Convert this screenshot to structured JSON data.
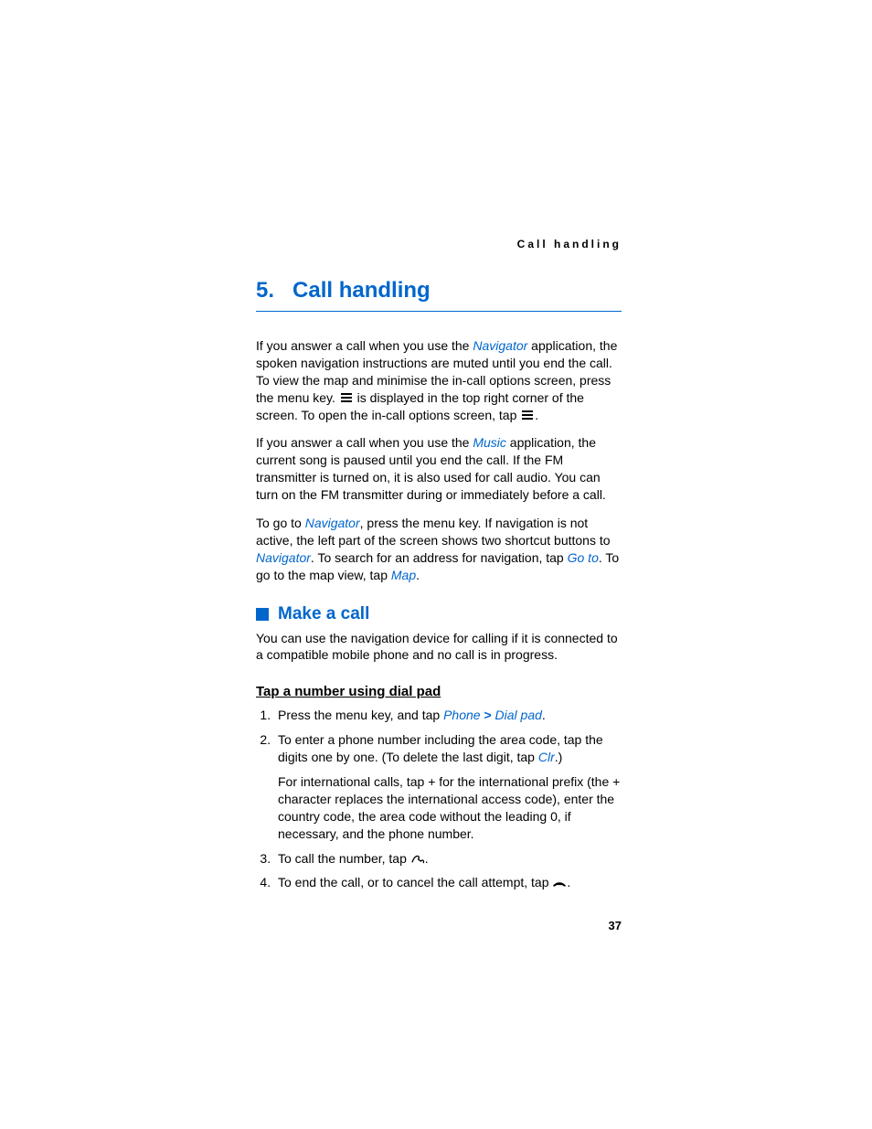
{
  "running_header": "Call handling",
  "chapter": {
    "number": "5.",
    "title": "Call handling"
  },
  "paragraphs": {
    "p1_a": "If you answer a call when you use the ",
    "p1_link1": "Navigator",
    "p1_b": " application, the spoken navigation instructions are muted until you end the call. To view the map and minimise the in-call options screen, press the menu key. ",
    "p1_c": " is displayed in the top right corner of the screen. To open the in-call options screen, tap ",
    "p1_d": ".",
    "p2_a": "If you answer a call when you use the ",
    "p2_link1": "Music",
    "p2_b": " application, the current song is paused until you end the call. If the FM transmitter is turned on, it is also used for call audio. You can turn on the FM transmitter during or immediately before a call.",
    "p3_a": "To go to ",
    "p3_link1": "Navigator",
    "p3_b": ", press the menu key. If navigation is not active, the left part of the screen shows two shortcut buttons to ",
    "p3_link2": "Navigator",
    "p3_c": ". To search for an address for navigation, tap ",
    "p3_link3": "Go to",
    "p3_d": ". To go to the map view, tap ",
    "p3_link4": "Map",
    "p3_e": "."
  },
  "section": {
    "title": "Make a call",
    "intro": "You can use the navigation device for calling if it is connected to a compatible mobile phone and no call is in progress."
  },
  "subsection": {
    "title": "Tap a number using dial pad",
    "steps": {
      "s1_a": "Press the menu key, and tap ",
      "s1_link1": "Phone",
      "s1_gt": " > ",
      "s1_link2": "Dial pad",
      "s1_b": ".",
      "s2_a": "To enter a phone number including the area code, tap the digits one by one. (To delete the last digit, tap ",
      "s2_link1": "Clr",
      "s2_b": ".)",
      "s2_sub": "For international calls, tap + for the international prefix (the + character replaces the international access code), enter the country code, the area code without the leading 0, if necessary, and the phone number.",
      "s3_a": "To call the number, tap ",
      "s3_b": ".",
      "s4_a": "To end the call, or to cancel the call attempt, tap ",
      "s4_b": "."
    }
  },
  "page_number": "37"
}
